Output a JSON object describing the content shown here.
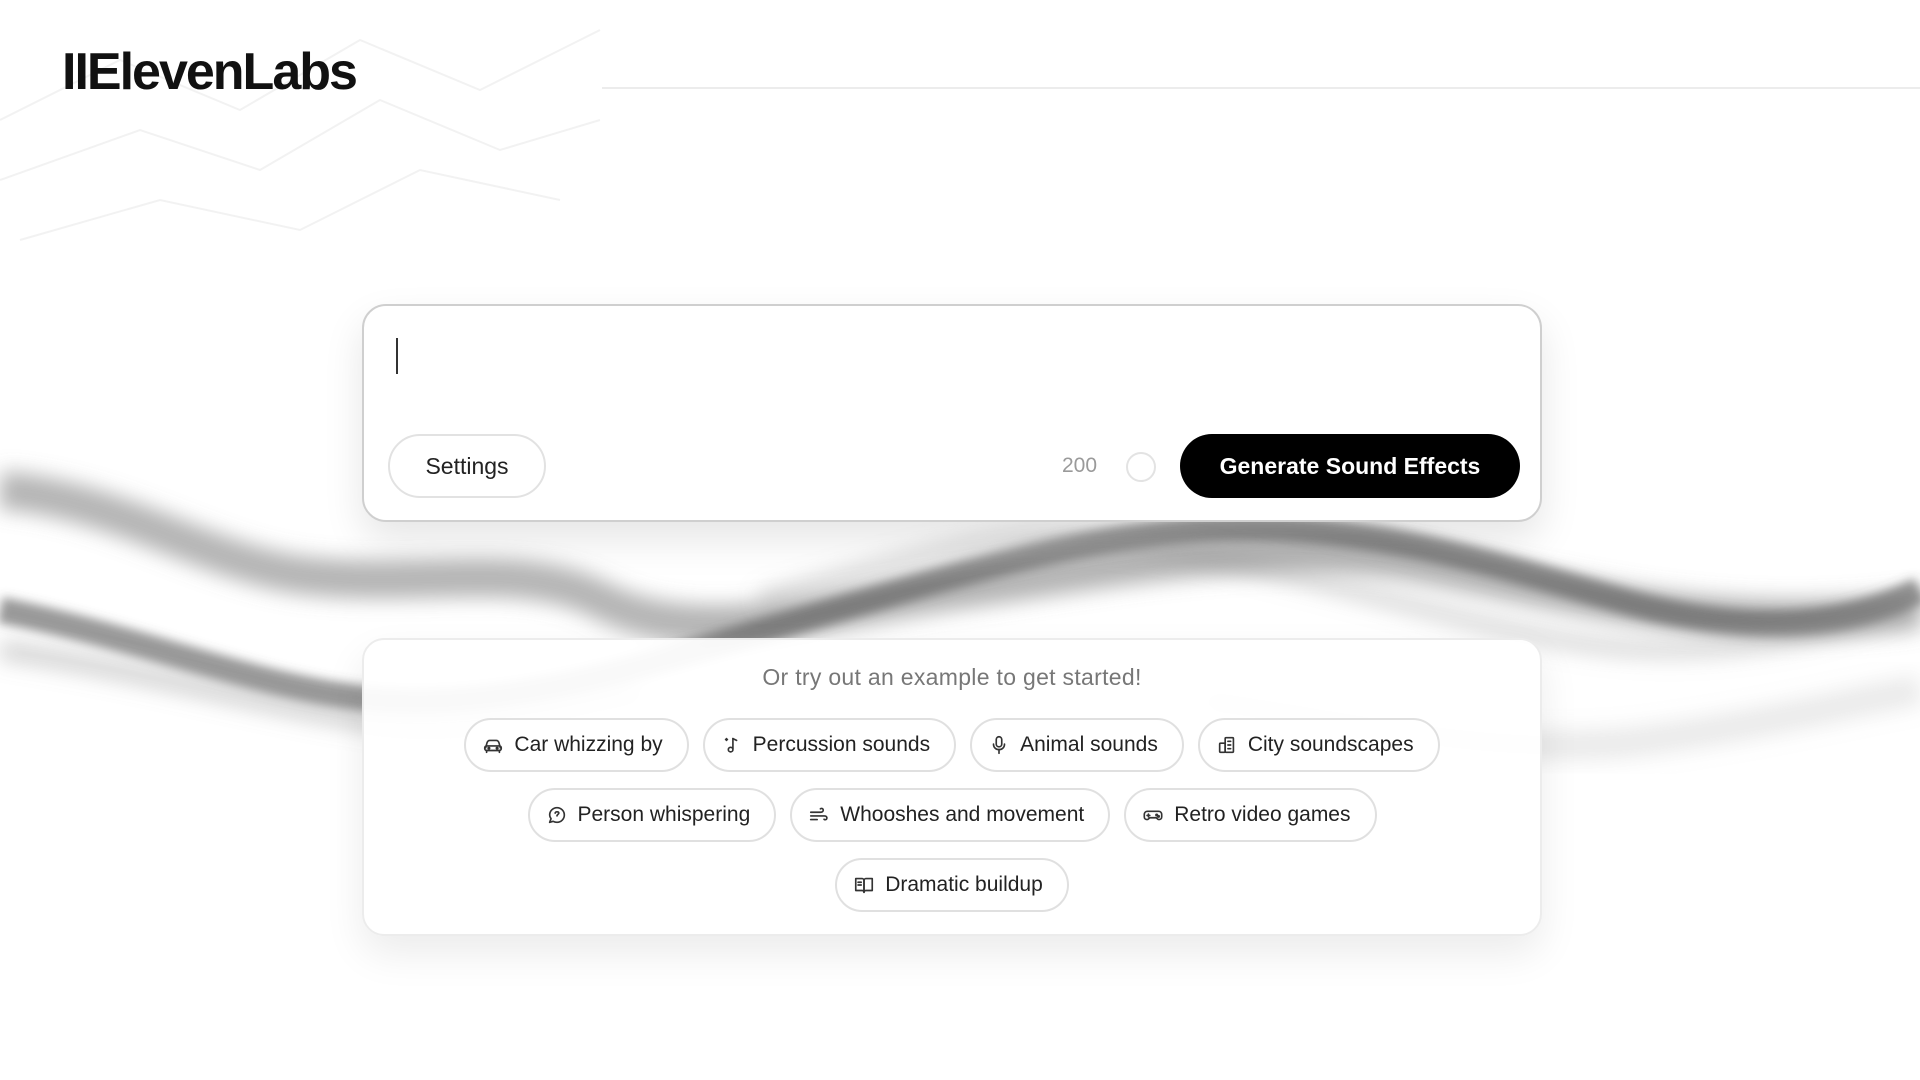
{
  "brand": {
    "logo_text": "IIElevenLabs"
  },
  "prompt": {
    "input_value": "",
    "input_placeholder": "",
    "settings_label": "Settings",
    "char_count": "200",
    "generate_label": "Generate Sound Effects"
  },
  "examples": {
    "heading": "Or try out an example to get started!",
    "chips": [
      {
        "label": "Car whizzing by",
        "icon": "car-icon"
      },
      {
        "label": "Percussion sounds",
        "icon": "music-note-icon"
      },
      {
        "label": "Animal sounds",
        "icon": "microphone-icon"
      },
      {
        "label": "City soundscapes",
        "icon": "building-icon"
      },
      {
        "label": "Person whispering",
        "icon": "whisper-icon"
      },
      {
        "label": "Whooshes and movement",
        "icon": "wind-icon"
      },
      {
        "label": "Retro video games",
        "icon": "gamepad-icon"
      },
      {
        "label": "Dramatic buildup",
        "icon": "book-icon"
      }
    ]
  },
  "colors": {
    "primary_button": "#000000",
    "primary_button_text": "#ffffff",
    "muted_text": "#777777",
    "border": "#e0e0e0"
  }
}
